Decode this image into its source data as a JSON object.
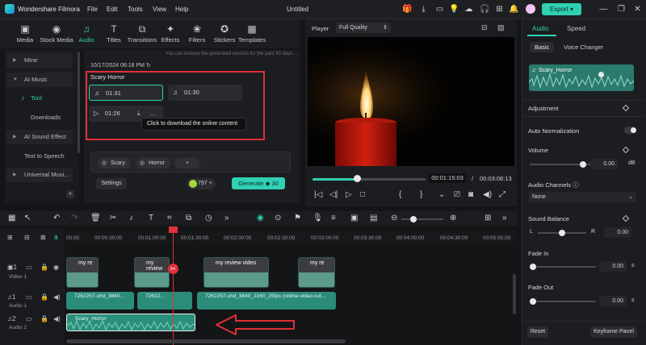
{
  "app": {
    "name": "Wondershare Filmora",
    "menu": [
      "File",
      "Edit",
      "Tools",
      "View",
      "Help"
    ],
    "document_title": "Untitled",
    "export_label": "Export"
  },
  "toolbar": {
    "items": [
      {
        "label": "Media",
        "icon": "media-icon"
      },
      {
        "label": "Stock Media",
        "icon": "stock-media-icon"
      },
      {
        "label": "Audio",
        "icon": "audio-icon"
      },
      {
        "label": "Titles",
        "icon": "titles-icon"
      },
      {
        "label": "Transitions",
        "icon": "transitions-icon"
      },
      {
        "label": "Effects",
        "icon": "effects-icon"
      },
      {
        "label": "Filters",
        "icon": "filters-icon"
      },
      {
        "label": "Stickers",
        "icon": "stickers-icon"
      },
      {
        "label": "Templates",
        "icon": "templates-icon"
      }
    ],
    "active": "Audio"
  },
  "leftnav": {
    "mine": "Mine",
    "ai_music": "AI Music",
    "tool": "Tool",
    "downloads": "Downloads",
    "ai_sound_effect": "AI Sound Effect",
    "text_to_speech": "Text to Speech",
    "universal_music": "Universal Musi..."
  },
  "music_panel": {
    "hint": "You can browse the generated records for the past 30 days.",
    "date": "10/17/2024 06:18 PM",
    "group_title": "Scary Horror",
    "clips": [
      "01:31",
      "01:30",
      "01:26"
    ],
    "tooltip": "Click to download the online content",
    "tags": [
      "Scary",
      "Horror",
      "+"
    ],
    "settings_label": "Settings",
    "credits": "797",
    "generate_label": "Generate",
    "generate_cost": "30"
  },
  "player": {
    "label": "Player",
    "quality": "Full Quality",
    "current_time": "00:01:15:03",
    "separator": "/",
    "total_time": "00:03:08:13",
    "progress": 0.39
  },
  "right_panel": {
    "tabs": [
      "Audio",
      "Speed"
    ],
    "subtabs": [
      "Basic",
      "Voice Changer"
    ],
    "clip_name": "Scary_Horror",
    "adjustment": "Adjustment",
    "auto_normalization": "Auto Normalization",
    "volume_label": "Volume",
    "volume_value": "0.00",
    "volume_unit": "dB",
    "audio_channels_label": "Audio Channels",
    "audio_channels_value": "None",
    "sound_balance_label": "Sound Balance",
    "balance_l": "L",
    "balance_r": "R",
    "balance_value": "0.00",
    "fade_in_label": "Fade In",
    "fade_in_value": "0.00",
    "fade_in_unit": "s",
    "fade_out_label": "Fade Out",
    "fade_out_value": "0.00",
    "fade_out_unit": "s",
    "reset_label": "Reset",
    "keyframe_label": "Keyframe Panel"
  },
  "timeline": {
    "ruler": [
      "00:00",
      "00:00:30:00",
      "00:01:00:00",
      "00:01:30:00",
      "00:02:00:00",
      "00:02:30:00",
      "00:03:00:00",
      "00:03:30:00",
      "00:04:00:00",
      "00:04:30:00",
      "00:05:00:00"
    ],
    "tracks": {
      "video1": "Video 1",
      "audio1": "Audio 1",
      "audio2": "Audio 2"
    },
    "video_clips": [
      "my re",
      "my review",
      "my review video",
      "my re"
    ],
    "audio1_clips": [
      "7262257-uhd_3840...",
      "72622...",
      "7262257-uhd_3840_2160_25fps (online-video-cut..."
    ],
    "audio2_clip": "Scary_Horror"
  },
  "colors": {
    "accent": "#2fd1b3",
    "highlight_box": "#e0303a",
    "playhead": "#e0303a"
  }
}
